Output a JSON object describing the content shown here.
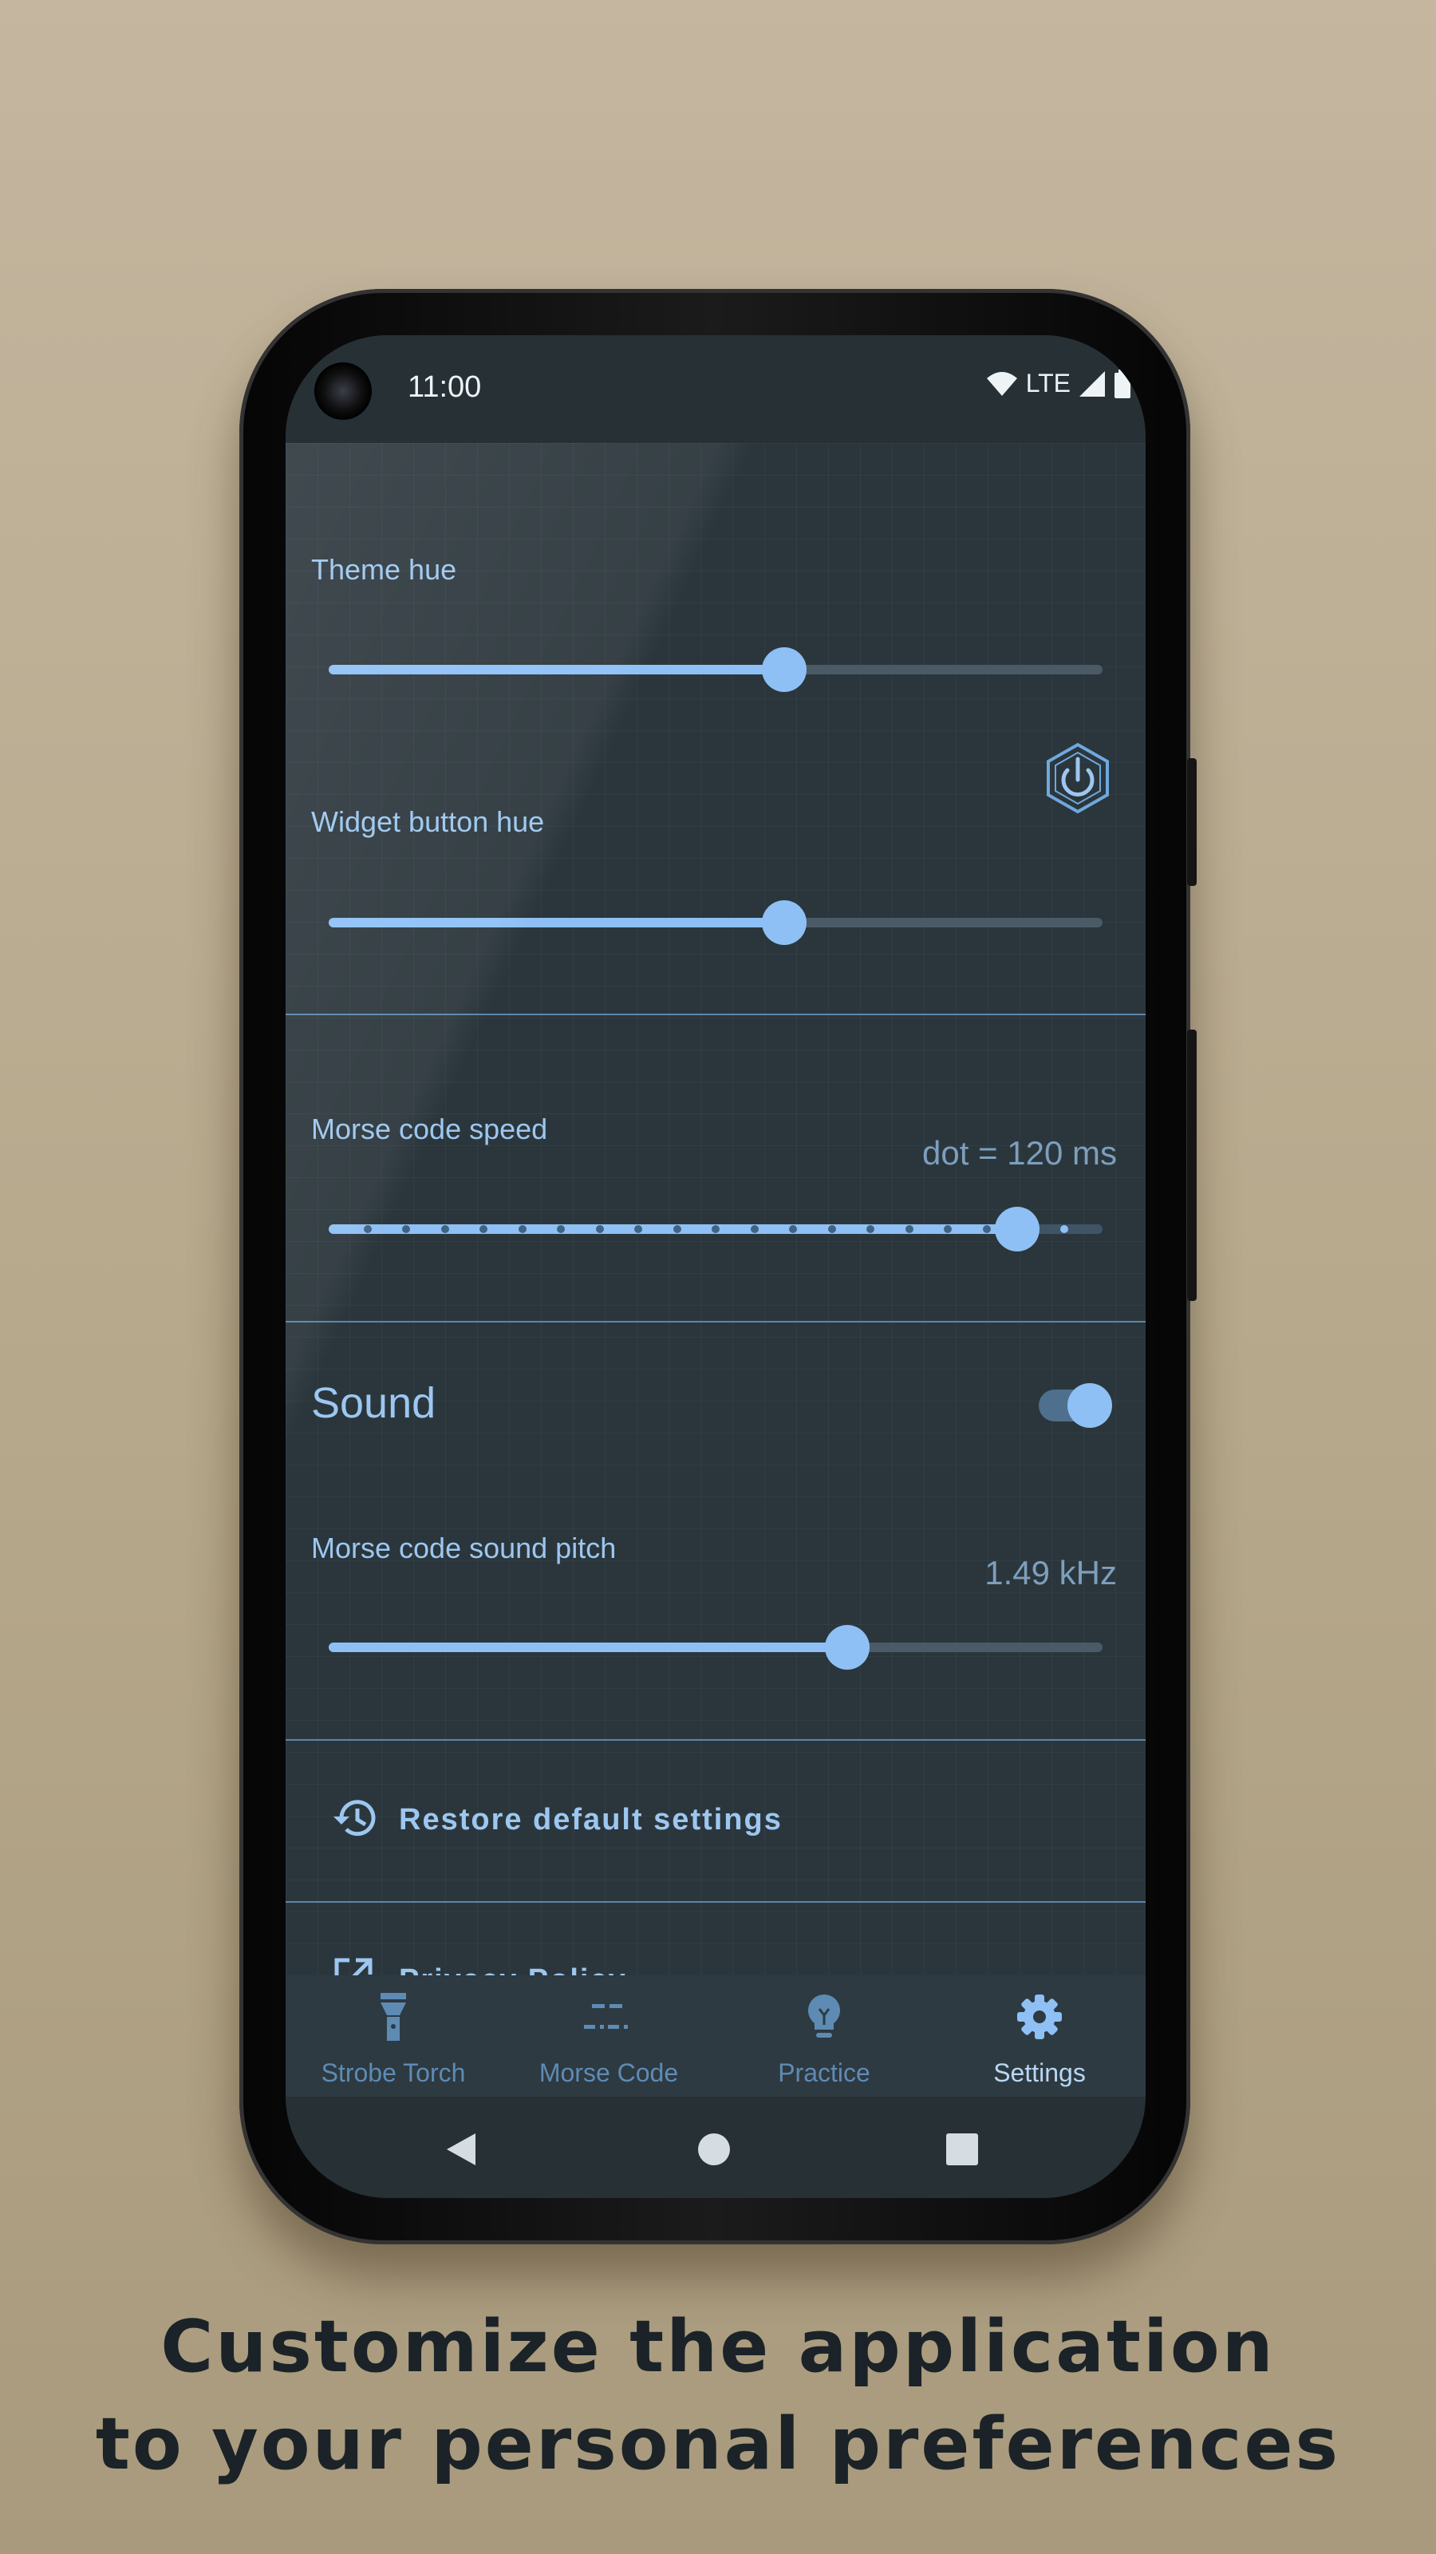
{
  "status_bar": {
    "time": "11:00",
    "network": "LTE",
    "icons": [
      "wifi-icon",
      "cell-signal-icon",
      "battery-icon"
    ]
  },
  "settings": {
    "theme_hue": {
      "label": "Theme hue",
      "level": 0.59
    },
    "widget_button_hue": {
      "label": "Widget button hue",
      "level": 0.59,
      "preview_icon": "power-button-icon"
    },
    "morse_speed": {
      "label": "Morse code speed",
      "value_text": "dot = 120 ms",
      "level": 0.89,
      "steps": 20
    },
    "sound": {
      "label": "Sound",
      "enabled": true
    },
    "sound_pitch": {
      "label": "Morse code sound pitch",
      "value_text": "1.49 kHz",
      "level": 0.67
    },
    "restore": {
      "label": "Restore default settings",
      "icon": "history-icon"
    },
    "privacy": {
      "label": "Privacy Policy",
      "icon": "external-link-icon"
    }
  },
  "bottom_nav": [
    {
      "label": "Strobe Torch",
      "icon": "flashlight-icon",
      "active": false
    },
    {
      "label": "Morse Code",
      "icon": "morse-icon",
      "active": false
    },
    {
      "label": "Practice",
      "icon": "lightbulb-icon",
      "active": false
    },
    {
      "label": "Settings",
      "icon": "gear-icon",
      "active": true
    }
  ],
  "system_nav": [
    "back-icon",
    "home-icon",
    "recents-icon"
  ],
  "caption": {
    "line1": "Customize the application",
    "line2": "to your personal preferences"
  },
  "colors": {
    "accent": "#8ec0f5",
    "background": "#2b363c",
    "page_bg": "#bfb197"
  }
}
